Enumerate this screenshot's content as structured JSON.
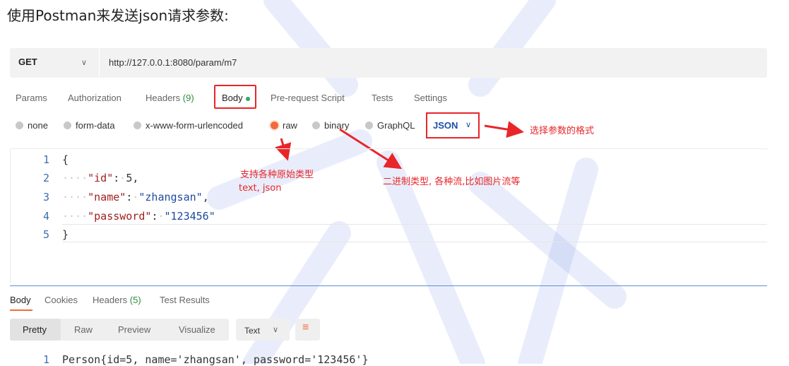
{
  "heading": "使用Postman来发送json请求参数:",
  "request": {
    "method": "GET",
    "url": "http://127.0.0.1:8080/param/m7"
  },
  "tabs": [
    {
      "label": "Params"
    },
    {
      "label": "Authorization"
    },
    {
      "label": "Headers",
      "count": "(9)"
    },
    {
      "label": "Body"
    },
    {
      "label": "Pre-request Script"
    },
    {
      "label": "Tests"
    },
    {
      "label": "Settings"
    }
  ],
  "body_modes": [
    "none",
    "form-data",
    "x-www-form-urlencoded",
    "raw",
    "binary",
    "GraphQL"
  ],
  "selected_mode": "raw",
  "format": "JSON",
  "editor": {
    "line_numbers": [
      "1",
      "2",
      "3",
      "4",
      "5"
    ],
    "open_brace": "{",
    "close_brace": "}",
    "key_id": "\"id\"",
    "val_id": "5,",
    "key_name": "\"name\"",
    "val_name": "\"zhangsan\"",
    "key_password": "\"password\"",
    "val_password": "\"123456\"",
    "colon": ":",
    "comma": ",",
    "indent": "····",
    "dot": "·"
  },
  "annotations": {
    "format": "选择参数的格式",
    "raw_line1": "支持各种原始类型",
    "raw_line2": "text, json",
    "binary": "二进制类型, 各种流,比如图片流等",
    "color": "#e8262a"
  },
  "response": {
    "tabs": [
      {
        "label": "Body"
      },
      {
        "label": "Cookies"
      },
      {
        "label": "Headers",
        "count": "(5)"
      },
      {
        "label": "Test Results"
      }
    ],
    "views": [
      "Pretty",
      "Raw",
      "Preview",
      "Visualize"
    ],
    "text_type": "Text",
    "line_number": "1",
    "output": "Person{id=5, name='zhangsan', password='123456'}"
  },
  "colors": {
    "accent": "#f26b3a",
    "annotation_red": "#e8262a",
    "json_blue": "#1a4fa8",
    "watermark": "#4d6fe0"
  }
}
